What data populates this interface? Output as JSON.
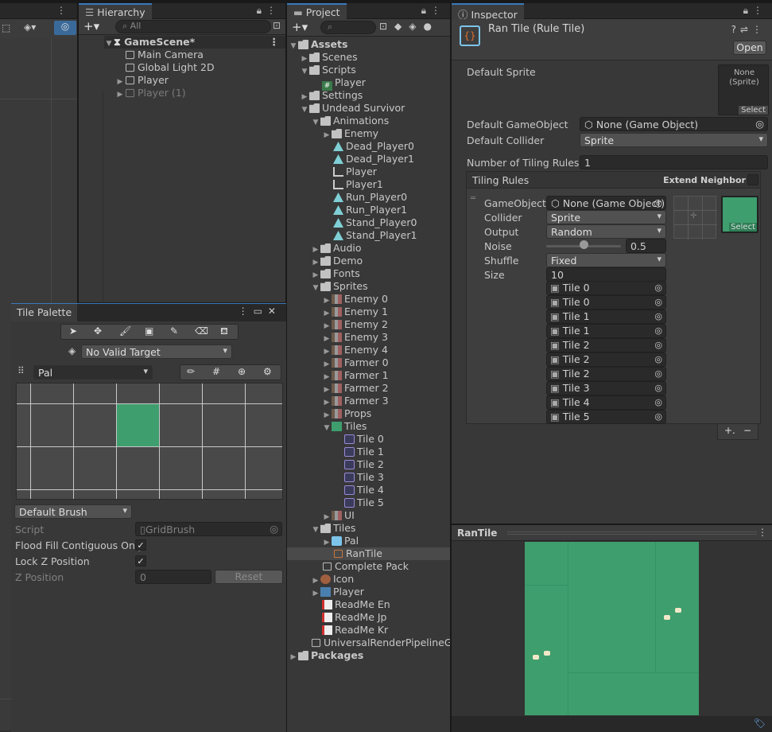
{
  "hierarchy": {
    "tab": "Hierarchy",
    "search_placeholder": "All",
    "scene": "GameScene*",
    "items": [
      {
        "label": "Main Camera"
      },
      {
        "label": "Global Light 2D"
      },
      {
        "label": "Player"
      },
      {
        "label": "Player (1)"
      }
    ]
  },
  "project": {
    "tab": "Project",
    "tree": [
      {
        "label": "Assets"
      },
      {
        "label": "Scenes"
      },
      {
        "label": "Scripts"
      },
      {
        "label": "Player"
      },
      {
        "label": "Settings"
      },
      {
        "label": "Undead Survivor"
      },
      {
        "label": "Animations"
      },
      {
        "label": "Enemy"
      },
      {
        "label": "Dead_Player0"
      },
      {
        "label": "Dead_Player1"
      },
      {
        "label": "Player"
      },
      {
        "label": "Player1"
      },
      {
        "label": "Run_Player0"
      },
      {
        "label": "Run_Player1"
      },
      {
        "label": "Stand_Player0"
      },
      {
        "label": "Stand_Player1"
      },
      {
        "label": "Audio"
      },
      {
        "label": "Demo"
      },
      {
        "label": "Fonts"
      },
      {
        "label": "Sprites"
      },
      {
        "label": "Enemy 0"
      },
      {
        "label": "Enemy 1"
      },
      {
        "label": "Enemy 2"
      },
      {
        "label": "Enemy 3"
      },
      {
        "label": "Enemy 4"
      },
      {
        "label": "Farmer 0"
      },
      {
        "label": "Farmer 1"
      },
      {
        "label": "Farmer 2"
      },
      {
        "label": "Farmer 3"
      },
      {
        "label": "Props"
      },
      {
        "label": "Tiles"
      },
      {
        "label": "Tile 0"
      },
      {
        "label": "Tile 1"
      },
      {
        "label": "Tile 2"
      },
      {
        "label": "Tile 3"
      },
      {
        "label": "Tile 4"
      },
      {
        "label": "Tile 5"
      },
      {
        "label": "UI"
      },
      {
        "label": "Tiles"
      },
      {
        "label": "Pal"
      },
      {
        "label": "RanTile"
      },
      {
        "label": "Complete Pack"
      },
      {
        "label": "Icon"
      },
      {
        "label": "Player"
      },
      {
        "label": "ReadMe En"
      },
      {
        "label": "ReadMe Jp"
      },
      {
        "label": "ReadMe Kr"
      },
      {
        "label": "UniversalRenderPipelineGlo"
      },
      {
        "label": "Packages"
      }
    ]
  },
  "inspector": {
    "tab": "Inspector",
    "title": "Ran Tile (Rule Tile)",
    "open_button": "Open",
    "default_sprite_label": "Default Sprite",
    "default_sprite_value": "None (Sprite)",
    "select_label": "Select",
    "default_gameobject_label": "Default GameObject",
    "default_gameobject_value": "None (Game Object)",
    "default_collider_label": "Default Collider",
    "default_collider_value": "Sprite",
    "tiling_rules_count_label": "Number of Tiling Rules",
    "tiling_rules_count_value": "1",
    "tiling_rules_header": "Tiling Rules",
    "extend_neighbor_label": "Extend Neighbor",
    "rule": {
      "gameobject_label": "GameObject",
      "gameobject_value": "None (Game Object)",
      "collider_label": "Collider",
      "collider_value": "Sprite",
      "output_label": "Output",
      "output_value": "Random",
      "noise_label": "Noise",
      "noise_value": "0.5",
      "noise_fraction": 0.5,
      "shuffle_label": "Shuffle",
      "shuffle_value": "Fixed",
      "size_label": "Size",
      "size_value": "10",
      "sprites": [
        "Tile 0",
        "Tile 0",
        "Tile 1",
        "Tile 1",
        "Tile 2",
        "Tile 2",
        "Tile 2",
        "Tile 3",
        "Tile 4",
        "Tile 5"
      ]
    },
    "plus": "+.",
    "minus": "−"
  },
  "preview": {
    "title": "RanTile"
  },
  "tile_palette": {
    "title": "Tile Palette",
    "target_value": "No Valid Target",
    "palette_value": "Pal",
    "brush_value": "Default Brush",
    "script_label": "Script",
    "script_value": "GridBrush",
    "flood_fill_label": "Flood Fill Contiguous Only",
    "flood_fill_checked": true,
    "lock_z_label": "Lock Z Position",
    "lock_z_checked": true,
    "z_position_label": "Z Position",
    "z_position_value": "0",
    "reset_button": "Reset"
  },
  "colors": {
    "accent": "#3a79bb",
    "tile_green": "#3e9e6e",
    "panel_bg": "#383838",
    "tab_bg": "#282828"
  }
}
